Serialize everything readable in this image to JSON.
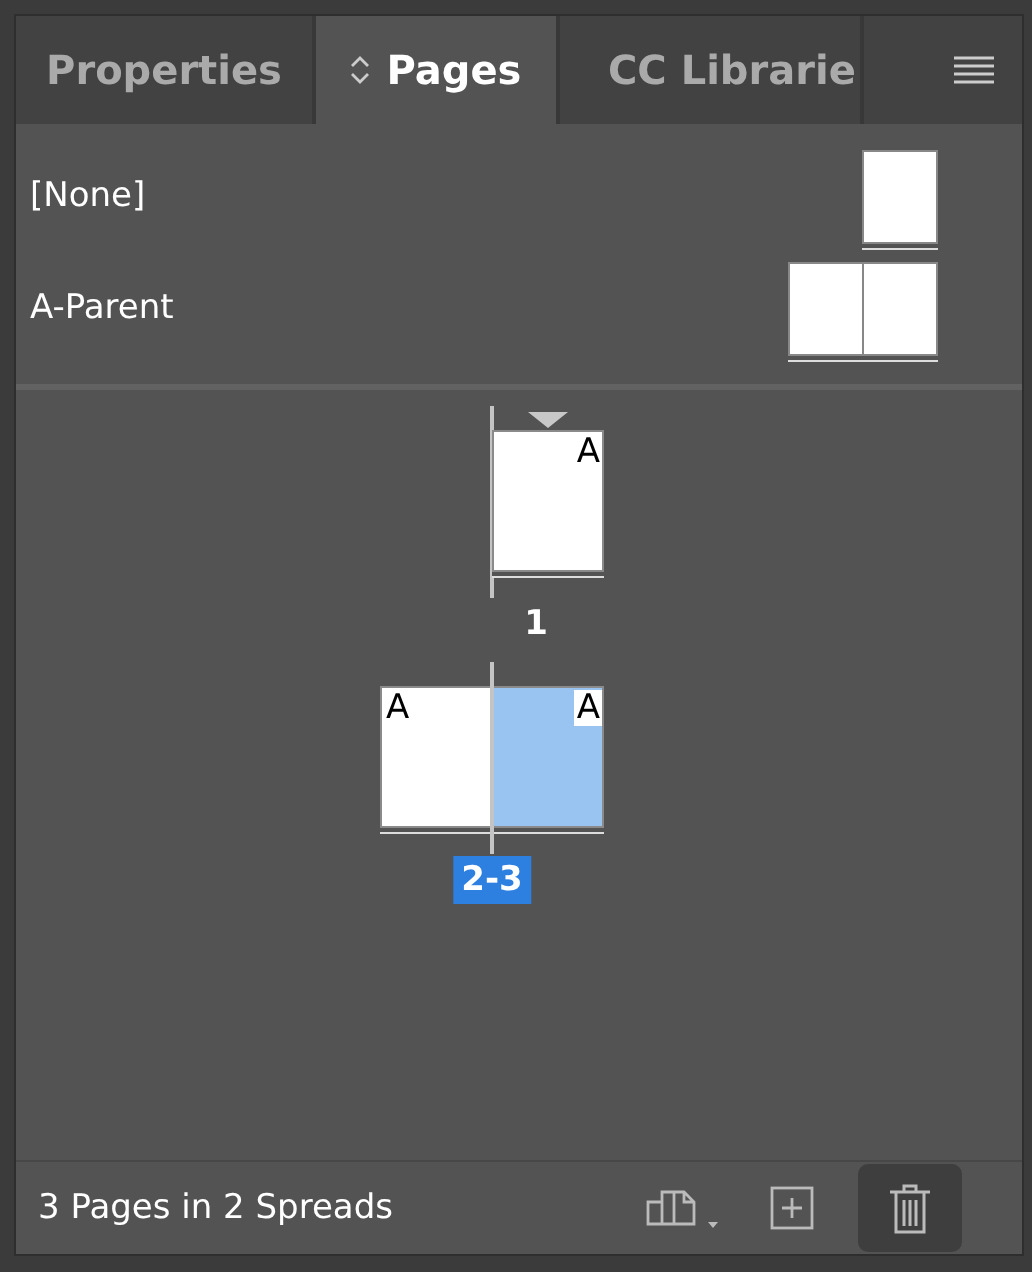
{
  "tabs": [
    {
      "label": "Properties",
      "selected": false
    },
    {
      "label": "Pages",
      "selected": true
    },
    {
      "label": "CC Librarie",
      "selected": false
    }
  ],
  "parents": [
    {
      "name": "[None]",
      "kind": "single"
    },
    {
      "name": "A-Parent",
      "kind": "facing"
    }
  ],
  "spreads": [
    {
      "label": "1",
      "selected": false,
      "pages": [
        {
          "kind": "right",
          "prefix": "A",
          "selected": false
        }
      ]
    },
    {
      "label": "2-3",
      "selected": true,
      "pages": [
        {
          "kind": "left",
          "prefix": "A",
          "selected": false
        },
        {
          "kind": "right",
          "prefix": "A",
          "selected": true
        }
      ]
    }
  ],
  "status": "3 Pages in 2 Spreads"
}
